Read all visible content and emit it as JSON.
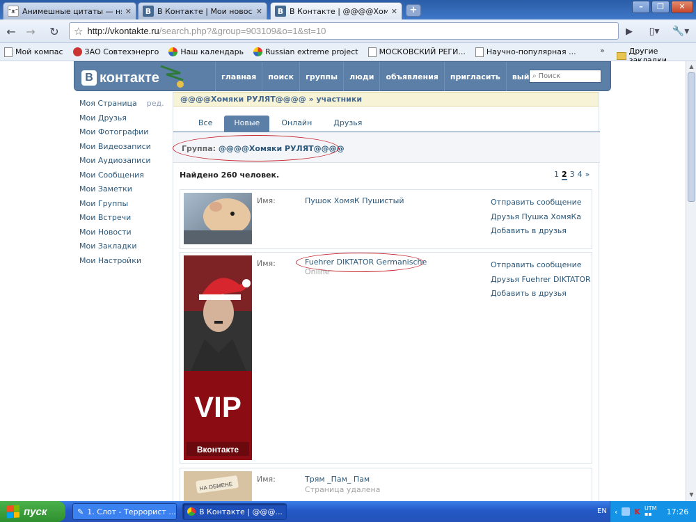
{
  "browser": {
    "tabs": [
      {
        "title": "Анимешные цитаты — ня..."
      },
      {
        "title": "В Контакте | Мои новост..."
      },
      {
        "title": "В Контакте | @@@@Хом..."
      }
    ],
    "url_domain": "http://vkontakte.ru",
    "url_path": "/search.php?&group=903109&o=1&st=10",
    "bookmarks": [
      "Мой компас",
      "ЗАО Совтехэнерго",
      "Наш календарь",
      "Russian extreme project",
      "МОСКОВСКИЙ РЕГИ...",
      "Научно-популярная ..."
    ],
    "other_bookmarks": "Другие закладки"
  },
  "vk": {
    "logo_text": "контакте",
    "nav": [
      "главная",
      "поиск",
      "группы",
      "люди",
      "объявления",
      "пригласить",
      "выйти"
    ],
    "search_placeholder": "Поиск",
    "menu": [
      "Моя Страница",
      "Мои Друзья",
      "Мои Фотографии",
      "Мои Видеозаписи",
      "Мои Аудиозаписи",
      "Мои Сообщения",
      "Мои Заметки",
      "Мои Группы",
      "Мои Встречи",
      "Мои Новости",
      "Мои Закладки",
      "Мои Настройки"
    ],
    "menu_edit": "ред.",
    "breadcrumb": {
      "group": "@@@@Хомяки РУЛЯТ@@@@",
      "section": "участники"
    },
    "tabs": [
      "Все",
      "Новые",
      "Онлайн",
      "Друзья"
    ],
    "group_label": "Группа:",
    "group_name": "@@@@Хомяки РУЛЯТ@@@@",
    "found_text": "Найдено 260 человек.",
    "pager": [
      "1",
      "2",
      "3",
      "4",
      "»"
    ],
    "members": [
      {
        "label": "Имя:",
        "name": "Пушок ХомяК Пушистый",
        "actions": [
          "Отправить сообщение",
          "Друзья Пушка ХомяКа",
          "Добавить в друзья"
        ]
      },
      {
        "label": "Имя:",
        "name": "Fuehrer DIKTATOR Germanische",
        "status": "Online",
        "actions": [
          "Отправить сообщение",
          "Друзья Fuehrer DIKTATOR",
          "Добавить в друзья"
        ]
      },
      {
        "label": "Имя:",
        "name": "Трям _Пам_ Пам",
        "status": "Страница удалена"
      }
    ]
  },
  "taskbar": {
    "start_label": "пуск",
    "items": [
      "1. Слот - Террорист ...",
      "В Контакте | @@@..."
    ],
    "lang": "EN",
    "clock": "17:26"
  }
}
